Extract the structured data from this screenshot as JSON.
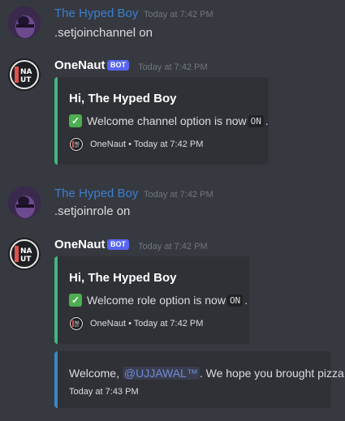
{
  "messages": [
    {
      "username": "The Hyped Boy",
      "timestamp": "Today at 7:42 PM",
      "content": ".setjoinchannel on"
    },
    {
      "username": "OneNaut",
      "bot_tag": "BOT",
      "timestamp": "Today at 7:42 PM",
      "embed": {
        "title": "Hi, The Hyped Boy",
        "desc_prefix": "Welcome channel option is now",
        "desc_code": "ON",
        "desc_suffix": ".",
        "footer": "OneNaut • Today at 7:42 PM"
      }
    },
    {
      "username": "The Hyped Boy",
      "timestamp": "Today at 7:42 PM",
      "content": ".setjoinrole on"
    },
    {
      "username": "OneNaut",
      "bot_tag": "BOT",
      "timestamp": "Today at 7:42 PM",
      "embed": {
        "title": "Hi, The Hyped Boy",
        "desc_prefix": "Welcome role option is now",
        "desc_code": "ON",
        "desc_suffix": ".",
        "footer": "OneNaut • Today at 7:42 PM"
      },
      "embed2": {
        "prefix": "Welcome,",
        "mention": "@UJJAWAL™",
        "suffix": ". We hope you brought pizza.",
        "footer": "Today at 7:43 PM"
      }
    }
  ],
  "colors": {
    "background": "#36393f",
    "embed_bg": "#2f3136",
    "green_bar": "#43b581",
    "blue_bar": "#3b88c3",
    "user_name": "#3b7fd1",
    "bot_tag": "#5865f2"
  },
  "icons": {
    "check": "white-check-mark-icon",
    "bot_avatar": "onenaut-logo-icon",
    "user_avatar": "user-avatar-icon"
  }
}
